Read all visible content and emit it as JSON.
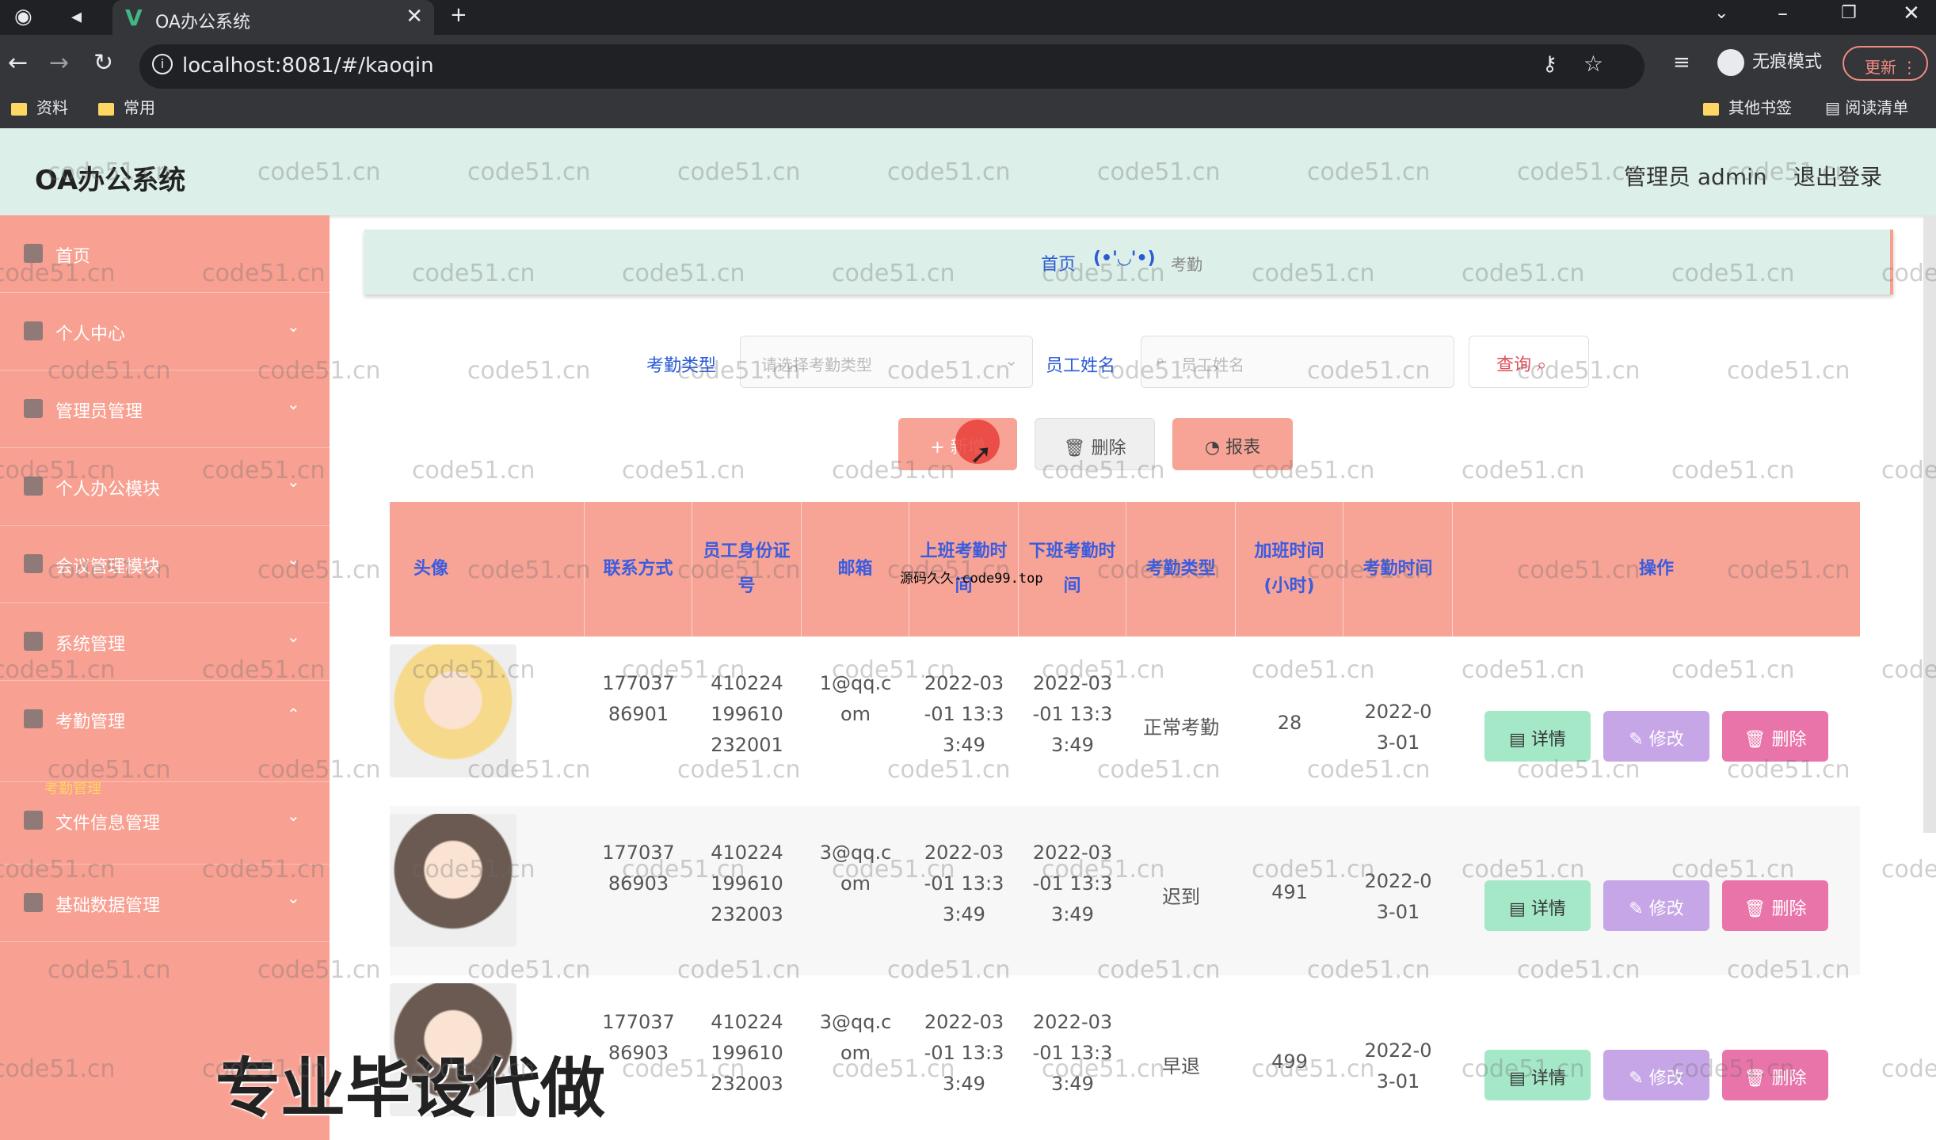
{
  "browser": {
    "tab_title": "OA办公系统",
    "url": "localhost:8081/#/kaoqin",
    "incognito_label": "无痕模式",
    "update_label": "更新",
    "bookmarks": [
      "资料",
      "常用"
    ],
    "other_bookmarks": "其他书签",
    "reading_list": "阅读清单"
  },
  "header": {
    "brand": "OA办公系统",
    "user": "管理员 admin",
    "logout": "退出登录"
  },
  "sidebar": {
    "items": [
      {
        "label": "首页"
      },
      {
        "label": "个人中心"
      },
      {
        "label": "管理员管理"
      },
      {
        "label": "个人办公模块"
      },
      {
        "label": "会议管理模块"
      },
      {
        "label": "系统管理"
      },
      {
        "label": "考勤管理"
      },
      {
        "label": "文件信息管理"
      },
      {
        "label": "基础数据管理"
      }
    ],
    "active_sub": "考勤管理"
  },
  "breadcrumb": {
    "home": "首页",
    "separator": "(•'◡'•)",
    "current": "考勤"
  },
  "filters": {
    "type_label": "考勤类型",
    "type_placeholder": "请选择考勤类型",
    "name_label": "员工姓名",
    "name_placeholder": "员工姓名",
    "query_label": "查询"
  },
  "actions": {
    "add": "新增",
    "delete": "删除",
    "report": "报表"
  },
  "table": {
    "columns": [
      "头像",
      "联系方式",
      "员工身份证号",
      "邮箱",
      "上班考勤时间",
      "下班考勤时间",
      "考勤类型",
      "加班时间(小时)",
      "考勤时间",
      "操作"
    ],
    "rows": [
      {
        "phone": "17703786901",
        "idcard": "410224199610232001",
        "email": "1@qq.com",
        "on_time": "2022-03-01 13:33:49",
        "off_time": "2022-03-01 13:33:49",
        "type": "正常考勤",
        "overtime": "28",
        "date": "2022-03-01",
        "avatar_color": "#f6d98a"
      },
      {
        "phone": "17703786903",
        "idcard": "410224199610232003",
        "email": "3@qq.com",
        "on_time": "2022-03-01 13:33:49",
        "off_time": "2022-03-01 13:33:49",
        "type": "迟到",
        "overtime": "491",
        "date": "2022-03-01",
        "avatar_color": "#6b5a52"
      },
      {
        "phone": "17703786903",
        "idcard": "410224199610232003",
        "email": "3@qq.com",
        "on_time": "2022-03-01 13:33:49",
        "off_time": "2022-03-01 13:33:49",
        "type": "早退",
        "overtime": "499",
        "date": "2022-03-01",
        "avatar_color": "#6b5a52"
      }
    ],
    "row_actions": {
      "detail": "详情",
      "edit": "修改",
      "delete": "删除"
    }
  },
  "watermark": "code51.cn",
  "overlay_text": "源码久久-code99.top",
  "banner_text": "专业毕设代做"
}
